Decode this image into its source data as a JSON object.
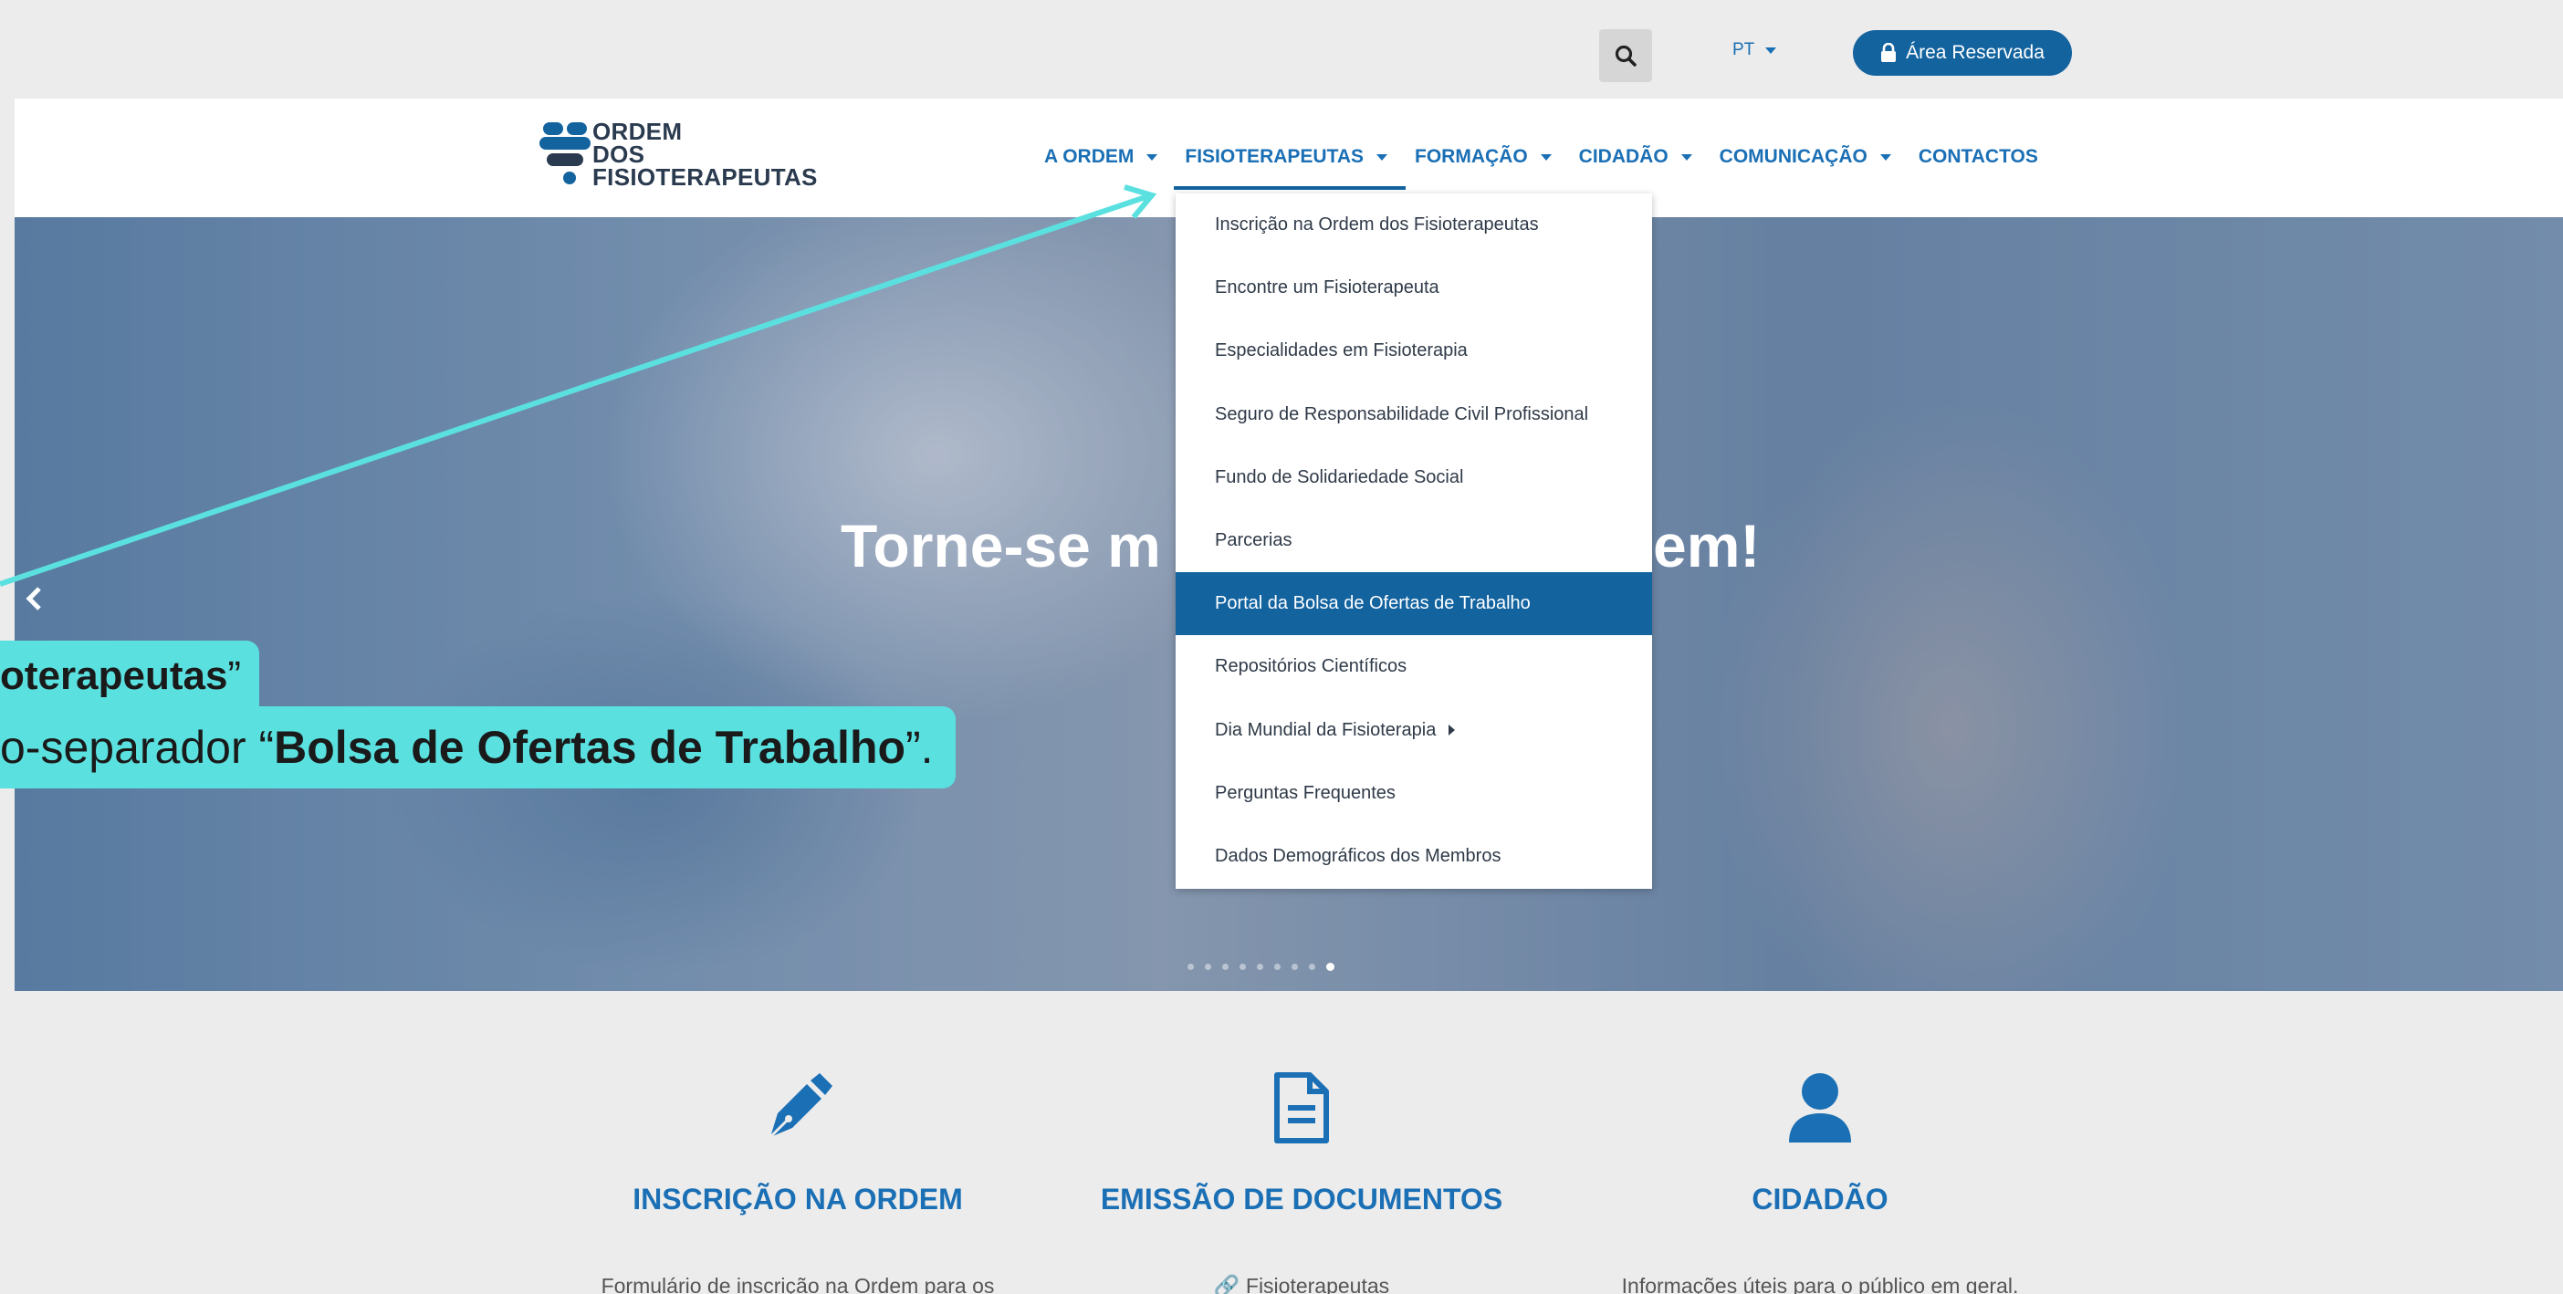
{
  "topbar": {
    "lang": "PT",
    "reserved_label": "Área Reservada"
  },
  "logo": {
    "line1": "ORDEM",
    "line2": "DOS",
    "line3": "FISIOTERAPEUTAS"
  },
  "menu": {
    "a_ordem": "A ORDEM",
    "fisioterapeutas": "FISIOTERAPEUTAS",
    "formacao": "FORMAÇÃO",
    "cidadao": "CIDADÃO",
    "comunicacao": "COMUNICAÇÃO",
    "contactos": "CONTACTOS"
  },
  "dropdown": {
    "items": [
      "Inscrição na Ordem dos Fisioterapeutas",
      "Encontre um Fisioterapeuta",
      "Especialidades em Fisioterapia",
      "Seguro de Responsabilidade Civil Profissional",
      "Fundo de Solidariedade Social",
      "Parcerias",
      "Portal da Bolsa de Ofertas de Trabalho",
      "Repositórios Científicos",
      "Dia Mundial da Fisioterapia",
      "Perguntas Frequentes",
      "Dados Demográficos dos Membros"
    ],
    "highlighted_index": 6
  },
  "hero": {
    "title_left": "Torne-se m",
    "title_right": "em!",
    "dots_total": 9,
    "active_dot": 9
  },
  "callout": {
    "line1_bold": "oterapeutas",
    "line1_end": "”",
    "line2_start": "o-separador “",
    "line2_bold": "Bolsa de Ofertas de Trabalho",
    "line2_end": "”."
  },
  "features": {
    "inscricao": {
      "title": "INSCRIÇÃO NA ORDEM",
      "text": "Formulário de inscrição na Ordem para os"
    },
    "emissao": {
      "title": "EMISSÃO DE DOCUMENTOS",
      "text": "Fisioterapeutas"
    },
    "cidadao": {
      "title": "CIDADÃO",
      "text": "Informações úteis para o público em geral."
    }
  },
  "colors": {
    "accent": "#13639f",
    "link": "#1a6fb5",
    "callout": "#5be0e0"
  }
}
